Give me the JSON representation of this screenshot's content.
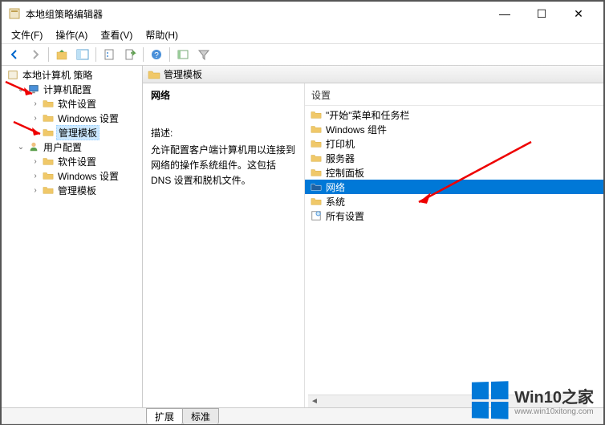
{
  "window": {
    "title": "本地组策略编辑器",
    "min_label": "—",
    "max_label": "☐",
    "close_label": "✕"
  },
  "menu": {
    "file": "文件(F)",
    "action": "操作(A)",
    "view": "查看(V)",
    "help": "帮助(H)"
  },
  "tree": {
    "root": "本地计算机 策略",
    "computer_config": "计算机配置",
    "software_settings_1": "软件设置",
    "windows_settings_1": "Windows 设置",
    "admin_templates_1": "管理模板",
    "user_config": "用户配置",
    "software_settings_2": "软件设置",
    "windows_settings_2": "Windows 设置",
    "admin_templates_2": "管理模板"
  },
  "content": {
    "header": "管理模板",
    "section_title": "网络",
    "desc_label": "描述:",
    "desc_text": "允许配置客户端计算机用以连接到网络的操作系统组件。这包括 DNS 设置和脱机文件。",
    "settings_label": "设置",
    "items": {
      "start_menu": "\"开始\"菜单和任务栏",
      "windows_components": "Windows 组件",
      "printers": "打印机",
      "servers": "服务器",
      "control_panel": "控制面板",
      "network": "网络",
      "system": "系统",
      "all_settings": "所有设置"
    }
  },
  "tabs": {
    "extended": "扩展",
    "standard": "标准"
  },
  "watermark": {
    "title": "Win10之家",
    "url": "www.win10xitong.com"
  }
}
